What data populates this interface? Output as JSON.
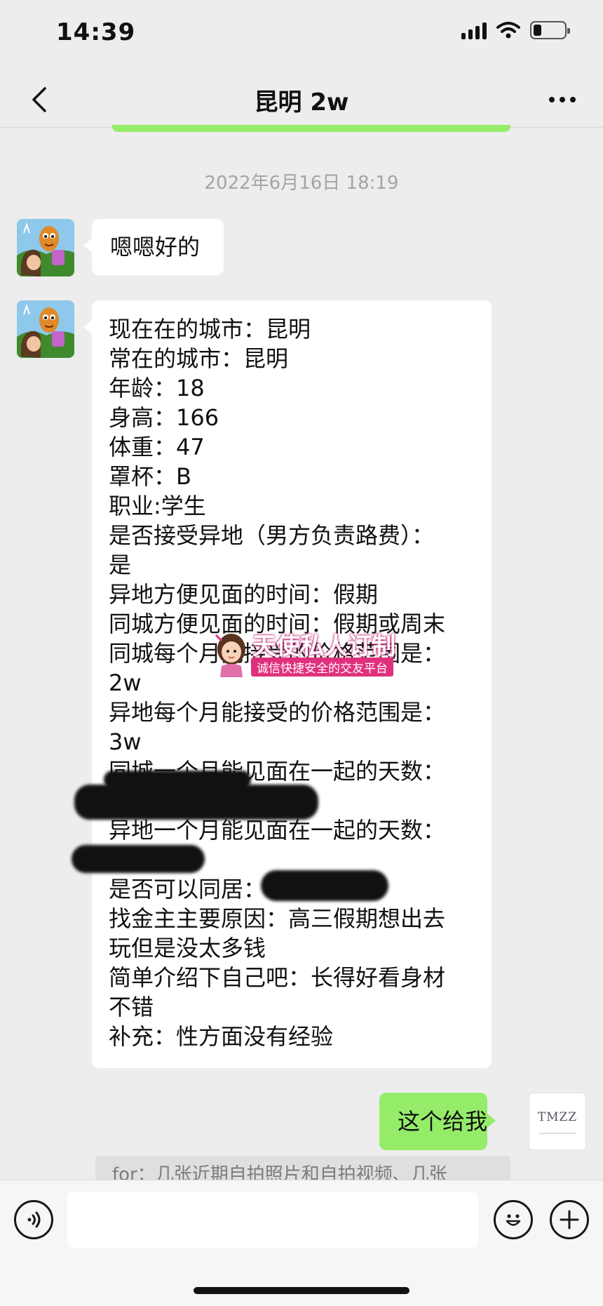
{
  "status_bar": {
    "time": "14:39",
    "battery_level_percent": 25
  },
  "nav": {
    "title": "昆明 2w",
    "back_icon": "chevron-left-icon",
    "more_icon": "more-dots-icon"
  },
  "timestamp": "2022年6月16日 18:19",
  "messages": {
    "m1": "嗯嗯好的",
    "m2_lines": [
      "现在在的城市：昆明",
      "常在的城市：昆明",
      "年龄：18",
      "身高：166",
      "体重：47",
      "罩杯：B",
      "职业:学生",
      "是否接受异地（男方负责路费）：",
      "是",
      "异地方便见面的时间：假期",
      "同城方便见面的时间：假期或周末",
      "同城每个月能接受的价格范围是：",
      "2w",
      "异地每个月能接受的价格范围是：",
      "3w",
      "同城一个月能见面在一起的天数：",
      "",
      "异地一个月能见面在一起的天数：",
      "",
      "是否可以同居：",
      "找金主主要原因：高三假期想出去",
      "玩但是没太多钱",
      "简单介绍下自己吧：长得好看身材",
      "不错",
      "补充：性方面没有经验"
    ],
    "m3": "这个给我"
  },
  "watermark": {
    "title": "天使私人订制",
    "subtitle": "诚信快捷安全的交友平台"
  },
  "right_avatar_text": "TMZZ",
  "quote": "for：几张近期自拍照片和自拍视频、几张",
  "colors": {
    "background": "#ededed",
    "sent_bubble": "#95ec69",
    "received_bubble": "#ffffff"
  }
}
